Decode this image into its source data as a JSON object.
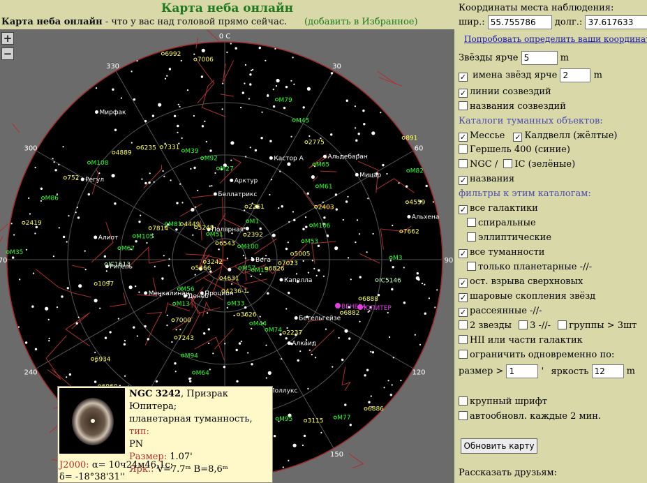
{
  "header": {
    "title": "Карта неба онлайн",
    "tagline_bold": "Карта неба онлайн",
    "tagline_rest": " - что у вас над головой прямо сейчас.",
    "favorite_link": "(добавить в Избранное)"
  },
  "map": {
    "zoom_in": "+",
    "zoom_out": "−",
    "azimuth_labels": [
      "0 С",
      "30",
      "60",
      "90",
      "120",
      "150",
      "240",
      "270",
      "300",
      "330"
    ],
    "stars": [
      "Вега",
      "Денеб",
      "Арктур",
      "Алкаид",
      "Алиот",
      "Мицар",
      "Дубхе",
      "Полярная",
      "Капелла",
      "Менкалинан",
      "Кастор А",
      "Поллукс",
      "Регул",
      "Альхена",
      "Процион",
      "Беллатрикс",
      "Бетельгейзе",
      "Ригель",
      "Альдебаран",
      "Альфард",
      "Мирфак"
    ],
    "objects": [
      "M57",
      "M56",
      "M27",
      "6882",
      "6934",
      "7006",
      "M15",
      "M13",
      "M92",
      "6888",
      "6960",
      "6992",
      "6826",
      "7000",
      "M39",
      "IC5146",
      "6946",
      "6543",
      "7023",
      "7243",
      "7331",
      "M3",
      "M101",
      "M51",
      "5005",
      "M94",
      "6235",
      "7662",
      "7479",
      "5248",
      "M53",
      "M64",
      "4889",
      "4559",
      "4631",
      "4449",
      "M106",
      "M109",
      "M108",
      "M82",
      "4236-1",
      "M81",
      "2403",
      "IC342",
      "752",
      "891",
      "M33",
      "7814",
      "M61",
      "M49",
      "M86",
      "M100",
      "3626",
      "M105",
      "M65",
      "M95",
      "2419",
      "2392",
      "M44",
      "M67",
      "2775",
      "3115",
      "M35",
      "M1",
      "M74",
      "IC1613",
      "M45",
      "M77",
      "3242",
      "2261",
      "2237",
      "1097",
      "M79",
      "6886",
      "5466"
    ],
    "planets": [
      "ВЕНЕРА",
      "ЮПИТЕР"
    ]
  },
  "popup": {
    "name": "NGC 3242",
    "desc": ", Призрак Юпитера;",
    "type_text": "планетарная туманность, ",
    "type_label": "тип:",
    "type_value": "PN",
    "size_label": "Размер: ",
    "size_value": "1.07'",
    "mag_label": "Ярк.: ",
    "mag_value": "V=7.7ᵐ B=8,6ᵐ",
    "j2000_label": "J2000: ",
    "ra_value": "α= 10ч24м46,1с;",
    "dec_value": "δ= -18°38'31''"
  },
  "panel": {
    "coords_title": "Координаты места наблюдения:",
    "lat_label": "шир.:",
    "lat_value": "55.755786",
    "lon_label": "долг.:",
    "lon_value": "37.617633",
    "auto_coords_link": "Попробовать определить ваши координаты",
    "stars_brighter_label": "Звёзды ярче",
    "stars_brighter_value": "5",
    "stars_brighter_unit": "m",
    "star_names_label": "имена звёзд ярче",
    "star_names_value": "2",
    "star_names_unit": "m",
    "constellation_lines": "линии созвездий",
    "constellation_names": "названия созвездий",
    "catalogs_title": "Каталоги туманных объектов:",
    "messier": "Мессье",
    "caldwell": "Калдвелл (жёлтые)",
    "herschel": "Гершель 400 (синие)",
    "ngc": "NGC /",
    "ic": "IC (зелёные)",
    "names": "названия",
    "filters_title": "фильтры к этим каталогам:",
    "all_galaxies": "все галактики",
    "spiral": "спиральные",
    "elliptical": "эллиптические",
    "all_nebulae": "все туманности",
    "planetary_only": "только планетарные -//-",
    "supernova": "ост. взрыва сверхновых",
    "globular": "шаровые скопления звёзд",
    "open_clusters": "рассеянные -//-",
    "two_stars": "2 звезды",
    "three_stars": "3 -//-",
    "groups": "группы > 3шт",
    "hii": "НII или части галактик",
    "limit_simultaneous": "ограничить одновременно по:",
    "size_label": "размер >",
    "size_value": "1",
    "size_unit": "'",
    "brightness_label": "яркость",
    "brightness_value": "12",
    "brightness_unit": "m",
    "large_font": "крупный шрифт",
    "autorefresh": "автообновл. каждые 2 мин.",
    "refresh_button": "Обновить карту",
    "share_label": "Рассказать друзьям:"
  }
}
